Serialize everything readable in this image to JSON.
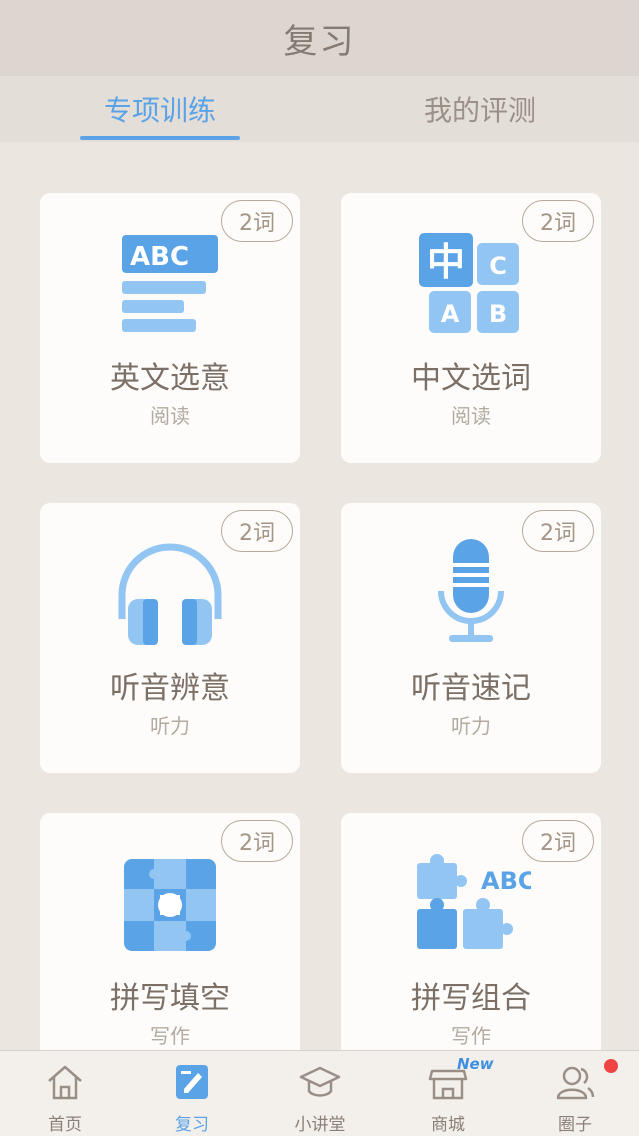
{
  "header": {
    "title": "复习"
  },
  "tabs": [
    {
      "label": "专项训练",
      "active": true
    },
    {
      "label": "我的评测",
      "active": false
    }
  ],
  "cards": [
    {
      "badge": "2词",
      "name": "英文选意",
      "category": "阅读",
      "icon": "abc-reading-icon"
    },
    {
      "badge": "2词",
      "name": "中文选词",
      "category": "阅读",
      "icon": "chinese-abc-blocks-icon"
    },
    {
      "badge": "2词",
      "name": "听音辨意",
      "category": "听力",
      "icon": "headphones-icon"
    },
    {
      "badge": "2词",
      "name": "听音速记",
      "category": "听力",
      "icon": "microphone-icon"
    },
    {
      "badge": "2词",
      "name": "拼写填空",
      "category": "写作",
      "icon": "puzzle-square-icon"
    },
    {
      "badge": "2词",
      "name": "拼写组合",
      "category": "写作",
      "icon": "puzzle-abc-icon"
    }
  ],
  "icon_text": {
    "abc": "ABC",
    "zhong": "中",
    "c": "C",
    "a": "A",
    "b": "B"
  },
  "bottom_nav": [
    {
      "label": "首页",
      "icon": "home-icon",
      "active": false
    },
    {
      "label": "复习",
      "icon": "review-notebook-icon",
      "active": true
    },
    {
      "label": "小讲堂",
      "icon": "graduation-cap-icon",
      "active": false
    },
    {
      "label": "商城",
      "icon": "shop-icon",
      "active": false,
      "tag": "New"
    },
    {
      "label": "圈子",
      "icon": "people-icon",
      "active": false,
      "notification_dot": true
    }
  ],
  "colors": {
    "accent": "#5aa3e6",
    "icon_dark": "#5aa3e6",
    "icon_light": "#93c5f3",
    "badge_border": "#b7aa9c",
    "notification": "#ee4444"
  }
}
